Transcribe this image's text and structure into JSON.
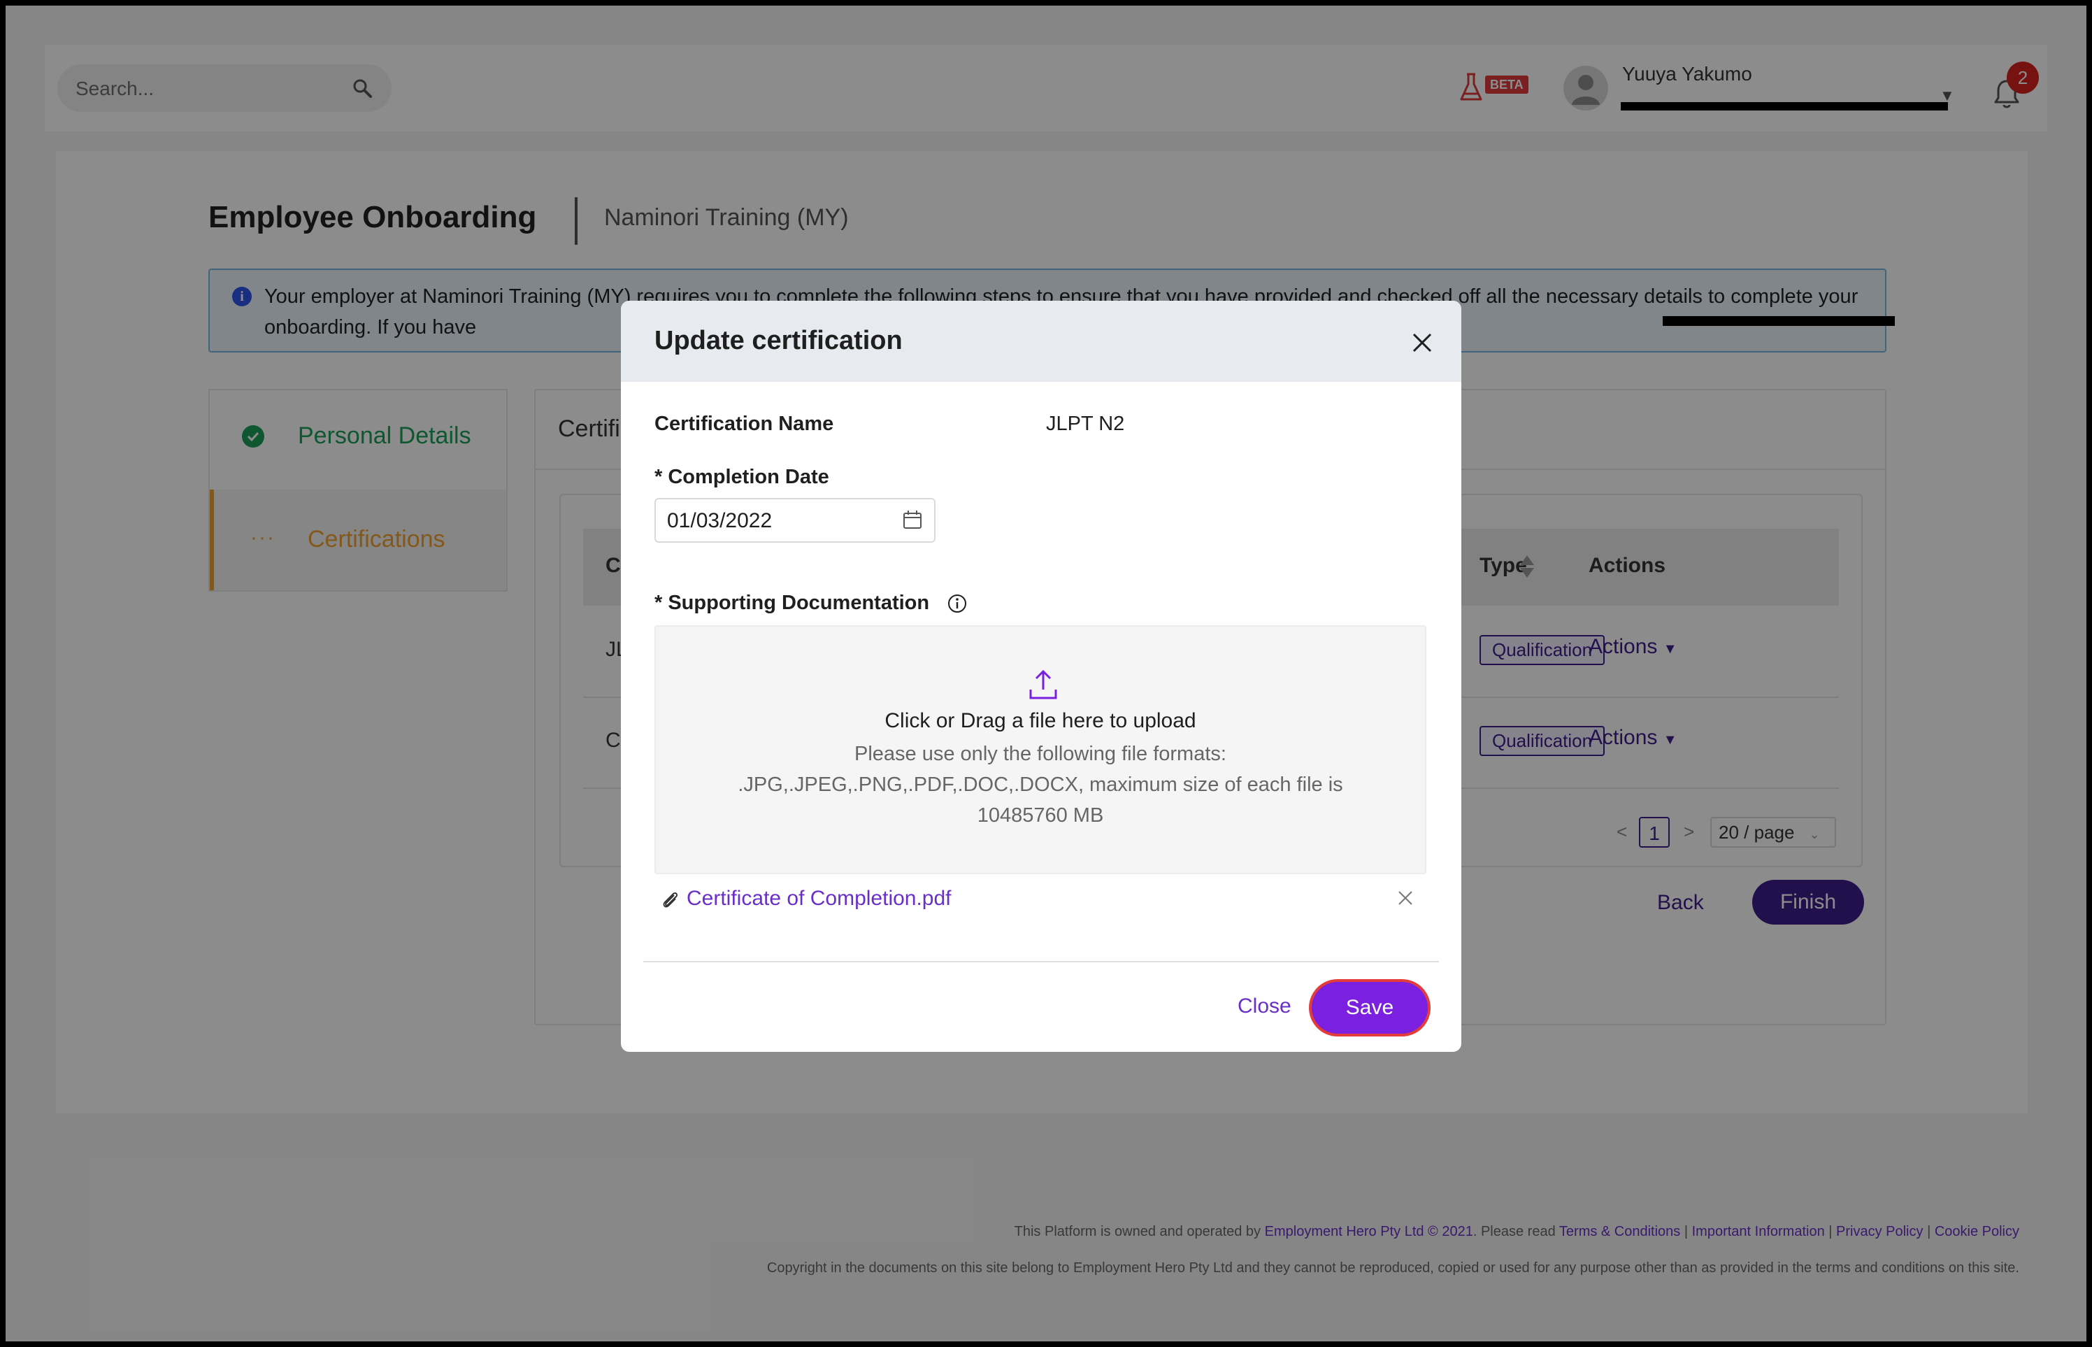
{
  "header": {
    "search_placeholder": "Search...",
    "beta_label": "BETA",
    "user_name": "Yuuya Yakumo",
    "notification_count": "2"
  },
  "page": {
    "title": "Employee Onboarding",
    "subtitle": "Naminori Training (MY)",
    "info_text": "Your employer at Naminori Training (MY) requires you to complete the following steps to ensure that you have provided and checked off all the necessary details to complete your onboarding. If you have"
  },
  "steps": [
    {
      "label": "Personal Details",
      "status": "complete"
    },
    {
      "label": "Certifications",
      "status": "in-progress"
    }
  ],
  "panel": {
    "title": "Certifi",
    "columns": {
      "name": "Ce",
      "type": "Type",
      "actions": "Actions"
    },
    "rows": [
      {
        "name": "JLI",
        "type": "Qualification",
        "actions": "Actions"
      },
      {
        "name": "CE",
        "type": "Qualification",
        "actions": "Actions"
      }
    ],
    "pagination": {
      "prev": "<",
      "current": "1",
      "next": ">",
      "page_size": "20 / page"
    },
    "back_label": "Back",
    "finish_label": "Finish"
  },
  "footer": {
    "line1_prefix": "This Platform is owned and operated by",
    "owner_link": "Employment Hero Pty Ltd © 2021",
    "line1_mid": ". Please read",
    "links": [
      "Terms & Conditions",
      "Important Information",
      "Privacy Policy",
      "Cookie Policy"
    ],
    "line2": "Copyright in the documents on this site belong to Employment Hero Pty Ltd and they cannot be reproduced, copied or used for any purpose other than as provided in the terms and conditions on this site."
  },
  "modal": {
    "title": "Update certification",
    "cert_name_label": "Certification Name",
    "cert_name_value": "JLPT N2",
    "completion_label": "* Completion Date",
    "completion_value": "01/03/2022",
    "docs_label": "* Supporting Documentation",
    "upload_main": "Click or Drag a file here to upload",
    "upload_sub": "Please use only the following file formats: .JPG,.JPEG,.PNG,.PDF,.DOC,.DOCX, maximum size of each file is 10485760 MB",
    "file_name": "Certificate of Completion.pdf",
    "close_label": "Close",
    "save_label": "Save"
  },
  "colors": {
    "brand_purple": "#3d1e8a",
    "accent_purple": "#7b1fe0",
    "success_green": "#1a9e5a",
    "progress_orange": "#f0a030",
    "info_blue": "#2f54eb",
    "highlight_red": "#e23c3c"
  }
}
